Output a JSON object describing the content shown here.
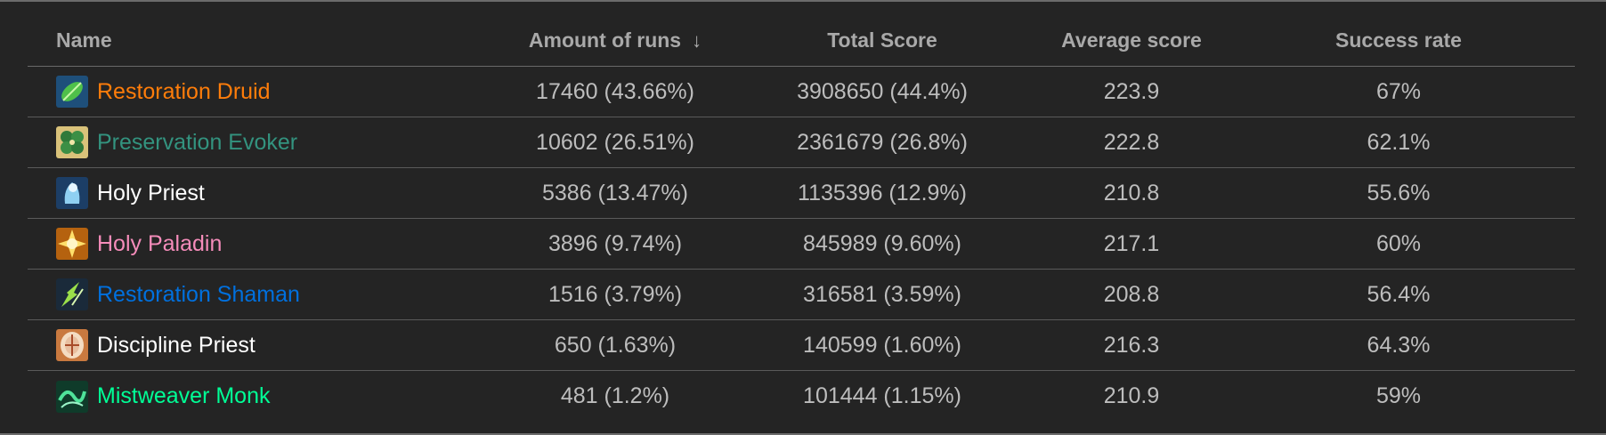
{
  "table": {
    "columns": {
      "name": "Name",
      "runs": "Amount of runs",
      "total": "Total Score",
      "avg": "Average score",
      "success": "Success rate"
    },
    "sort_icon": "arrow-down-icon",
    "rows": [
      {
        "name": "Restoration Druid",
        "name_color": "#ff7d0a",
        "icon": "restoration-druid-icon",
        "runs": "17460 (43.66%)",
        "total": "3908650 (44.4%)",
        "avg": "223.9",
        "success": "67%"
      },
      {
        "name": "Preservation Evoker",
        "name_color": "#33937f",
        "icon": "preservation-evoker-icon",
        "runs": "10602 (26.51%)",
        "total": "2361679 (26.8%)",
        "avg": "222.8",
        "success": "62.1%"
      },
      {
        "name": "Holy Priest",
        "name_color": "#ffffff",
        "icon": "holy-priest-icon",
        "runs": "5386 (13.47%)",
        "total": "1135396 (12.9%)",
        "avg": "210.8",
        "success": "55.6%"
      },
      {
        "name": "Holy Paladin",
        "name_color": "#f58cba",
        "icon": "holy-paladin-icon",
        "runs": "3896 (9.74%)",
        "total": "845989 (9.60%)",
        "avg": "217.1",
        "success": "60%"
      },
      {
        "name": "Restoration Shaman",
        "name_color": "#0070de",
        "icon": "restoration-shaman-icon",
        "runs": "1516 (3.79%)",
        "total": "316581 (3.59%)",
        "avg": "208.8",
        "success": "56.4%"
      },
      {
        "name": "Discipline Priest",
        "name_color": "#ffffff",
        "icon": "discipline-priest-icon",
        "runs": "650 (1.63%)",
        "total": "140599 (1.60%)",
        "avg": "216.3",
        "success": "64.3%"
      },
      {
        "name": "Mistweaver Monk",
        "name_color": "#00ff96",
        "icon": "mistweaver-monk-icon",
        "runs": "481 (1.2%)",
        "total": "101444 (1.15%)",
        "avg": "210.9",
        "success": "59%"
      }
    ]
  }
}
